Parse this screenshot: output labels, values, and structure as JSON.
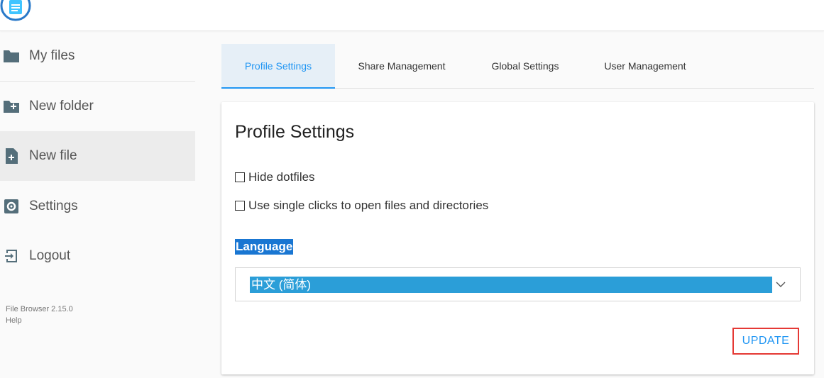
{
  "sidebar": {
    "items": [
      {
        "label": "My files",
        "icon": "folder-icon"
      },
      {
        "label": "New folder",
        "icon": "folder-plus-icon"
      },
      {
        "label": "New file",
        "icon": "file-plus-icon"
      },
      {
        "label": "Settings",
        "icon": "gear-icon"
      },
      {
        "label": "Logout",
        "icon": "logout-icon"
      }
    ],
    "active_item": "New file",
    "footer": {
      "version": "File Browser 2.15.0",
      "help": "Help"
    }
  },
  "tabs": [
    {
      "label": "Profile Settings",
      "active": true
    },
    {
      "label": "Share Management",
      "active": false
    },
    {
      "label": "Global Settings",
      "active": false
    },
    {
      "label": "User Management",
      "active": false
    }
  ],
  "profile": {
    "title": "Profile Settings",
    "hide_dotfiles_label": "Hide dotfiles",
    "hide_dotfiles_checked": false,
    "single_click_label": "Use single clicks to open files and directories",
    "single_click_checked": false,
    "language_label": "Language",
    "language_value": "中文 (简体)",
    "update_label": "UPDATE"
  },
  "colors": {
    "accent": "#2196f3",
    "active_tab_bg": "#e6eff7",
    "selection": "#2b9ed8",
    "highlight_border": "#e53935"
  }
}
